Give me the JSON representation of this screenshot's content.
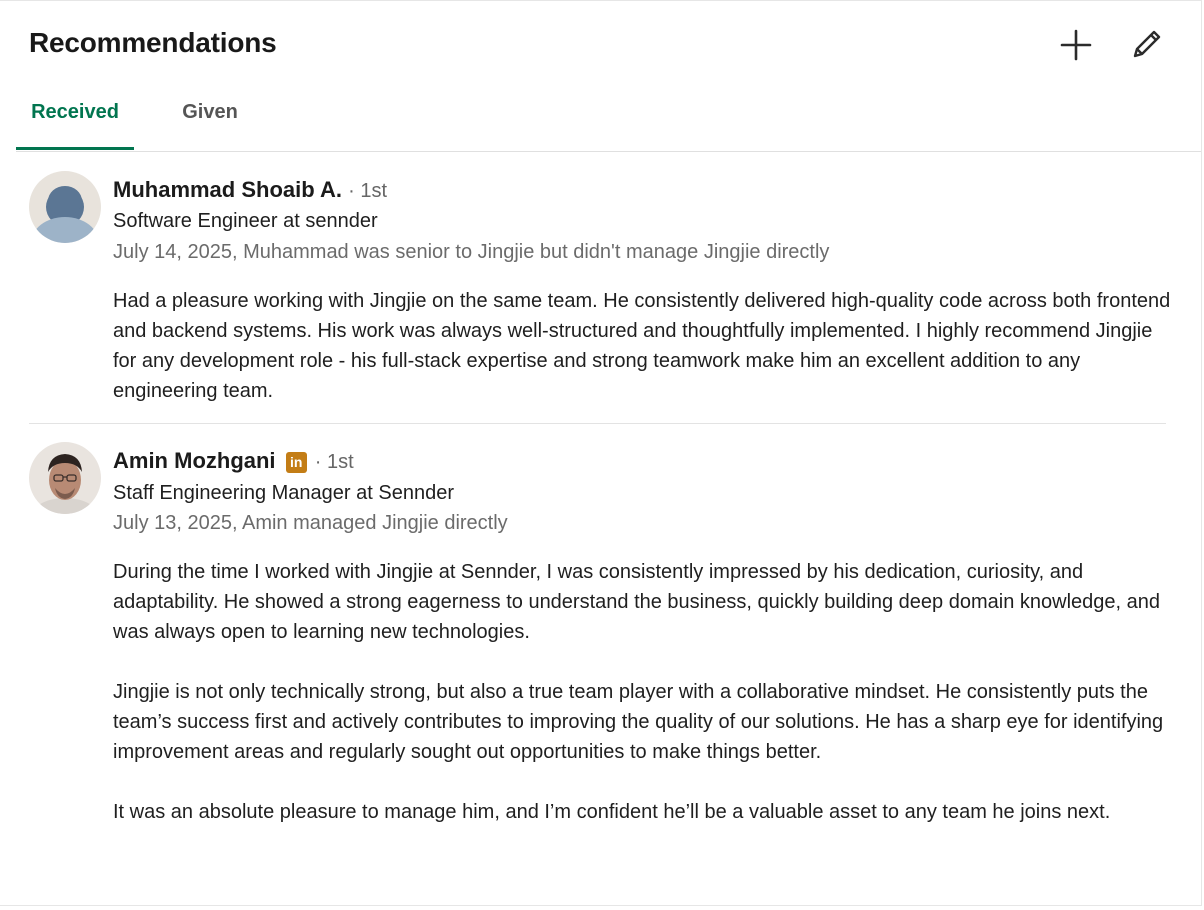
{
  "header": {
    "title": "Recommendations",
    "add_icon": "plus-icon",
    "edit_icon": "pencil-icon"
  },
  "tabs": [
    {
      "label": "Received",
      "active": true
    },
    {
      "label": "Given",
      "active": false
    }
  ],
  "recommendations": [
    {
      "name": "Muhammad Shoaib A.",
      "badge": false,
      "degree": "· 1st",
      "headline": "Software Engineer at sennder",
      "meta": "July 14, 2025, Muhammad was senior to Jingjie but didn't manage Jingjie directly",
      "paragraphs": [
        "Had a pleasure working with Jingjie on the same team. He consistently delivered high-quality code across both frontend and backend systems. His work was always well-structured and thoughtfully implemented. I highly recommend Jingjie for any development role - his full-stack expertise and strong teamwork make him an excellent addition to any engineering team."
      ]
    },
    {
      "name": "Amin Mozhgani",
      "badge": true,
      "badge_text": "in",
      "degree": "· 1st",
      "headline": "Staff Engineering Manager at Sennder",
      "meta": "July 13, 2025, Amin managed Jingjie directly",
      "paragraphs": [
        "During the time I worked with Jingjie at Sennder, I was consistently impressed by his dedication, curiosity, and adaptability. He showed a strong eagerness to understand the business, quickly building deep domain knowledge, and was always open to learning new technologies.",
        "Jingjie is not only technically strong, but also a true team player with a collaborative mindset. He consistently puts the team’s success first and actively contributes to improving the quality of our solutions. He has a sharp eye for identifying improvement areas and regularly sought out opportunities to make things better.",
        "It was an absolute pleasure to manage him, and I’m confident he’ll be a valuable asset to any team he joins next."
      ]
    }
  ],
  "colors": {
    "accent": "#01754f",
    "badge": "#c37d16",
    "muted_text": "#6b6b6b"
  }
}
